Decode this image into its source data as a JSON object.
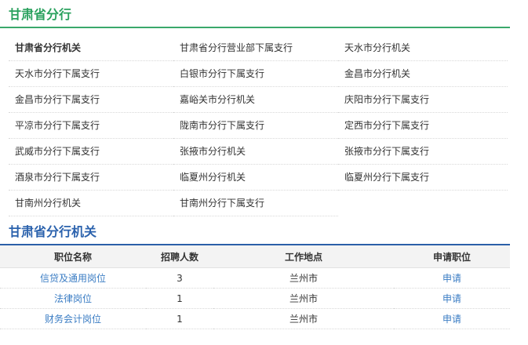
{
  "header": {
    "title": "甘肃省分行"
  },
  "branches": [
    "甘肃省分行机关",
    "甘肃省分行营业部下属支行",
    "天水市分行机关",
    "天水市分行下属支行",
    "白银市分行下属支行",
    "金昌市分行机关",
    "金昌市分行下属支行",
    "嘉峪关市分行机关",
    "庆阳市分行下属支行",
    "平凉市分行下属支行",
    "陇南市分行下属支行",
    "定西市分行下属支行",
    "武威市分行下属支行",
    "张掖市分行机关",
    "张掖市分行下属支行",
    "酒泉市分行下属支行",
    "临夏州分行机关",
    "临夏州分行下属支行",
    "甘南州分行机关",
    "甘南州分行下属支行"
  ],
  "selected_section": {
    "title": "甘肃省分行机关"
  },
  "jobs_table": {
    "headers": [
      "职位名称",
      "招聘人数",
      "工作地点",
      "申请职位"
    ],
    "rows": [
      {
        "title": "信贷及通用岗位",
        "count": "3",
        "location": "兰州市",
        "apply": "申请"
      },
      {
        "title": "法律岗位",
        "count": "1",
        "location": "兰州市",
        "apply": "申请"
      },
      {
        "title": "财务会计岗位",
        "count": "1",
        "location": "兰州市",
        "apply": "申请"
      }
    ]
  },
  "colors": {
    "green_accent": "#2aa15e",
    "blue_accent": "#2b62ad",
    "link": "#3b7dc4"
  }
}
